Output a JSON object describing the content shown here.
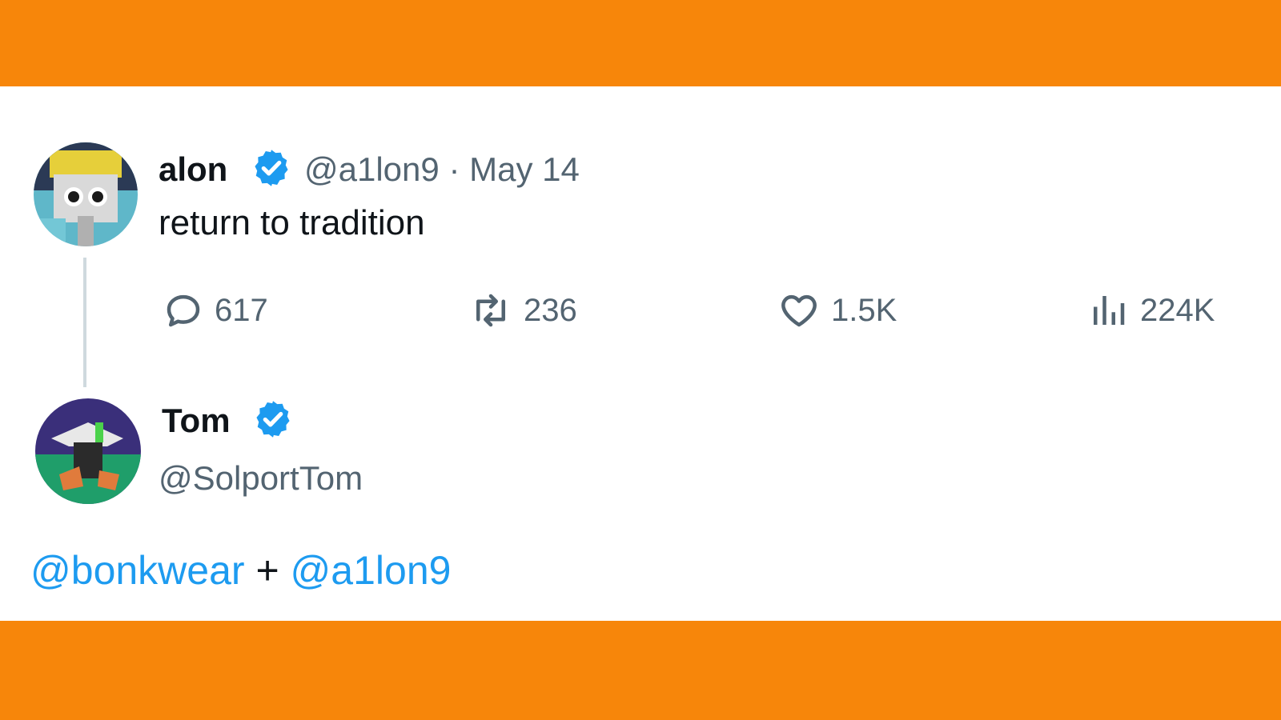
{
  "colors": {
    "band": "#f7860a",
    "link": "#1d9bf0",
    "verified": "#1d9bf0",
    "muted": "#536471"
  },
  "tweet": {
    "name": "alon",
    "handle": "@a1lon9",
    "separator": "·",
    "date": "May 14",
    "text": "return to tradition",
    "actions": {
      "reply": {
        "icon": "reply-bubble-icon",
        "count": "617"
      },
      "repost": {
        "icon": "repost-icon",
        "count": "236"
      },
      "like": {
        "icon": "heart-icon",
        "count": "1.5K"
      },
      "views": {
        "icon": "views-bar-chart-icon",
        "count": "224K"
      }
    }
  },
  "reply": {
    "name": "Tom",
    "handle": "@SolportTom",
    "mention_1": "@bonkwear",
    "plus": " + ",
    "mention_2": "@a1lon9"
  }
}
